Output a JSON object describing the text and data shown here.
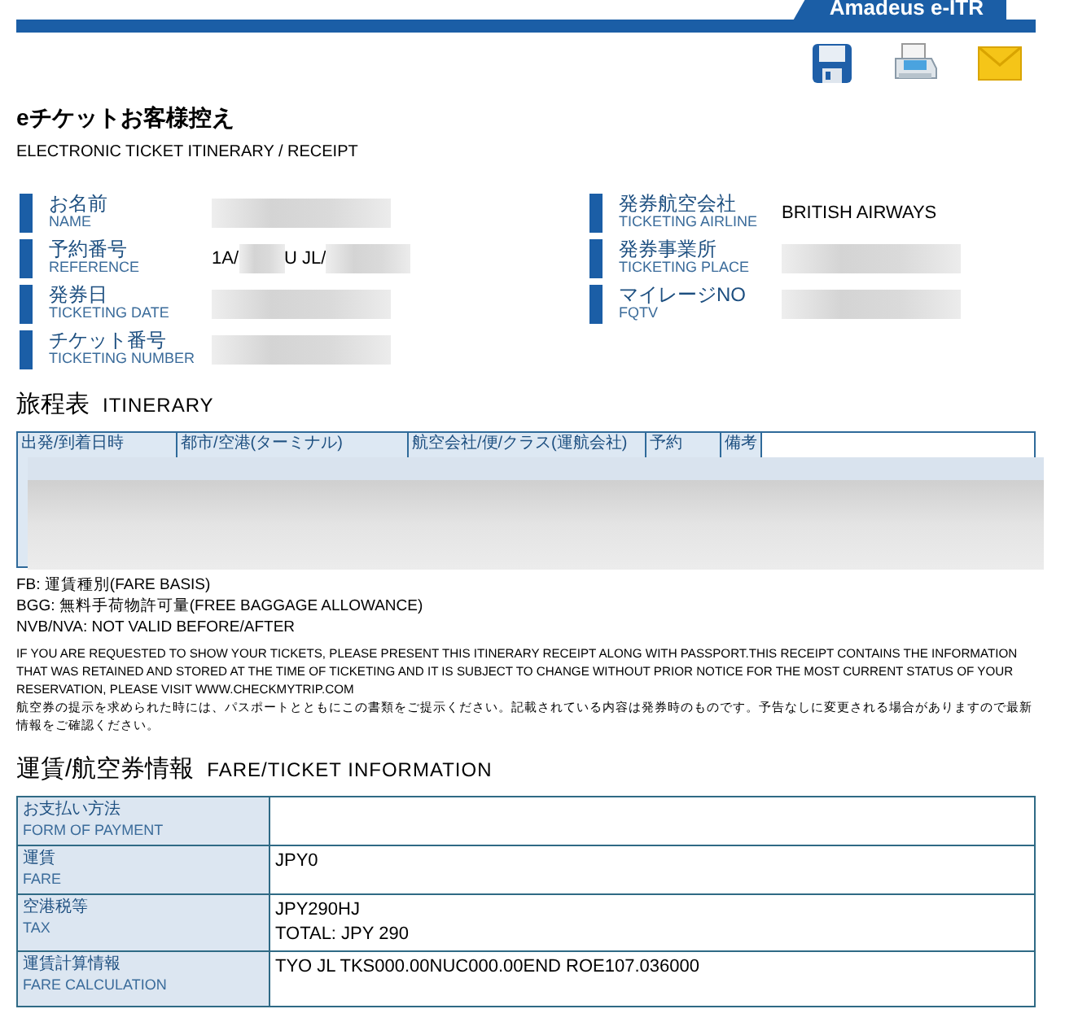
{
  "brand": "Amadeus e-ITR",
  "title": "eチケットお客様控え",
  "subtitle": "ELECTRONIC TICKET ITINERARY / RECEIPT",
  "info_left": [
    {
      "label": "お名前",
      "label_en": "NAME"
    },
    {
      "label": "予約番号",
      "label_en": "REFERENCE",
      "value_parts": [
        "1A/",
        "U JL/"
      ]
    },
    {
      "label": "発券日",
      "label_en": "TICKETING DATE"
    },
    {
      "label": "チケット番号",
      "label_en": "TICKETING NUMBER"
    }
  ],
  "info_right": [
    {
      "label": "発券航空会社",
      "label_en": "TICKETING AIRLINE",
      "value_parts": [
        "BRITISH AIRWAYS"
      ]
    },
    {
      "label": "発券事業所",
      "label_en": "TICKETING PLACE"
    },
    {
      "label": "マイレージNO",
      "label_en": "FQTV"
    }
  ],
  "itinerary": {
    "heading": "旅程表",
    "heading_en": "ITINERARY",
    "columns": [
      "出発/到着日時",
      "都市/空港(ターミナル)",
      "航空会社/便/クラス(運航会社)",
      "予約",
      "備考"
    ]
  },
  "notes": [
    "FB: 運賃種別(FARE BASIS)",
    "BGG: 無料手荷物許可量(FREE BAGGAGE ALLOWANCE)",
    "NVB/NVA: NOT VALID BEFORE/AFTER"
  ],
  "disclaimer": "IF YOU ARE REQUESTED TO SHOW YOUR TICKETS, PLEASE PRESENT THIS ITINERARY RECEIPT ALONG WITH PASSPORT.THIS RECEIPT CONTAINS THE INFORMATION THAT WAS RETAINED AND STORED AT THE TIME OF TICKETING AND IT IS SUBJECT TO CHANGE WITHOUT PRIOR NOTICE FOR THE MOST CURRENT STATUS OF YOUR RESERVATION, PLEASE VISIT WWW.CHECKMYTRIP.COM",
  "disclaimer_jp": "航空券の提示を求められた時には、パスポートとともにこの書類をご提示ください。記載されている内容は発券時のものです。予告なしに変更される場合がありますので最新情報をご確認ください。",
  "fare": {
    "heading": "運賃/航空券情報",
    "heading_en": "FARE/TICKET INFORMATION",
    "rows": [
      {
        "label": "お支払い方法",
        "label_en": "FORM OF PAYMENT",
        "lines": []
      },
      {
        "label": "運賃",
        "label_en": "FARE",
        "lines": [
          "JPY0"
        ]
      },
      {
        "label": "空港税等",
        "label_en": "TAX",
        "lines": [
          "JPY290HJ",
          "TOTAL: JPY 290"
        ]
      },
      {
        "label": "運賃計算情報",
        "label_en": "FARE CALCULATION",
        "lines": [
          "TYO JL TKS000.00NUC000.00END ROE107.036000"
        ]
      }
    ]
  }
}
